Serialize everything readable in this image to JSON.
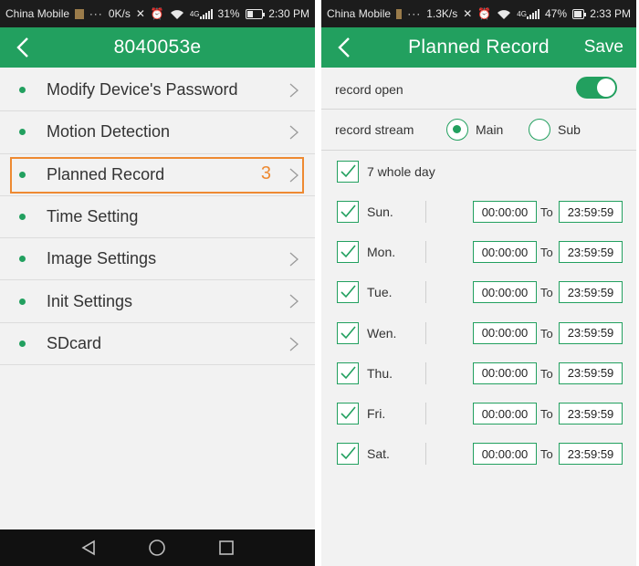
{
  "left": {
    "status": {
      "carrier": "China Mobile",
      "dots": "···",
      "speed": "0K/s",
      "network": "4G",
      "battery": "31%",
      "battery_level": 0.31,
      "time": "2:30 PM"
    },
    "header": {
      "title": "8040053e"
    },
    "menu": [
      {
        "label": "Modify Device's Password",
        "chevron": true
      },
      {
        "label": "Motion Detection",
        "chevron": true
      },
      {
        "label": "Planned Record",
        "chevron": true,
        "badge": "3",
        "highlighted": true
      },
      {
        "label": "Time Setting",
        "chevron": false
      },
      {
        "label": "Image Settings",
        "chevron": true
      },
      {
        "label": "Init Settings",
        "chevron": true
      },
      {
        "label": "SDcard",
        "chevron": true
      }
    ]
  },
  "right": {
    "status": {
      "carrier": "China Mobile",
      "dots": "···",
      "speed": "1.3K/s",
      "network": "4G",
      "battery": "47%",
      "battery_level": 0.47,
      "time": "2:33 PM"
    },
    "header": {
      "title": "Planned Record",
      "save": "Save"
    },
    "record_open": {
      "label": "record open",
      "on": true
    },
    "record_stream": {
      "label": "record stream",
      "options": [
        "Main",
        "Sub"
      ],
      "selected": "Main"
    },
    "whole_day": {
      "label": "7 whole day",
      "checked": true
    },
    "to_label": "To",
    "days": [
      {
        "label": "Sun.",
        "start": "00:00:00",
        "end": "23:59:59",
        "checked": true
      },
      {
        "label": "Mon.",
        "start": "00:00:00",
        "end": "23:59:59",
        "checked": true
      },
      {
        "label": "Tue.",
        "start": "00:00:00",
        "end": "23:59:59",
        "checked": true
      },
      {
        "label": "Wen.",
        "start": "00:00:00",
        "end": "23:59:59",
        "checked": true
      },
      {
        "label": "Thu.",
        "start": "00:00:00",
        "end": "23:59:59",
        "checked": true
      },
      {
        "label": "Fri.",
        "start": "00:00:00",
        "end": "23:59:59",
        "checked": true
      },
      {
        "label": "Sat.",
        "start": "00:00:00",
        "end": "23:59:59",
        "checked": true
      }
    ]
  },
  "colors": {
    "accent": "#22a05f",
    "highlight": "#ee8a32",
    "statusbar": "#1c1c1c",
    "navbar": "#111111"
  }
}
